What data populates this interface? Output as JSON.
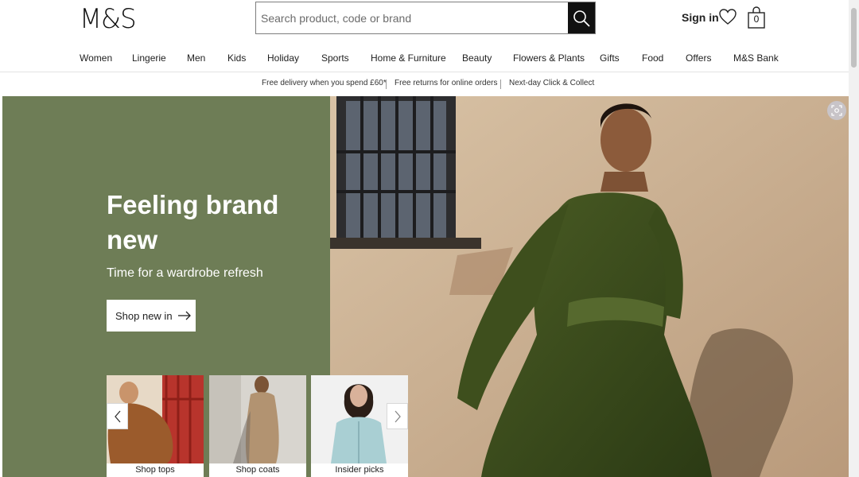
{
  "header": {
    "logo": "M&S",
    "search_placeholder": "Search product, code or brand",
    "sign_in": "Sign in",
    "bag_count": "0"
  },
  "nav": {
    "items": [
      "Women",
      "Lingerie",
      "Men",
      "Kids",
      "Holiday",
      "Sports",
      "Home & Furniture",
      "Beauty",
      "Flowers & Plants",
      "Gifts",
      "Food",
      "Offers",
      "M&S Bank"
    ]
  },
  "promo": {
    "items": [
      "Free delivery when you spend £60*",
      "Free returns for online orders",
      "Next-day Click & Collect"
    ]
  },
  "hero": {
    "title": "Feeling brand new",
    "subtitle": "Time for a wardrobe refresh",
    "cta": "Shop new in"
  },
  "tiles": [
    {
      "label": "Shop tops"
    },
    {
      "label": "Shop coats"
    },
    {
      "label": "Insider picks"
    }
  ],
  "colors": {
    "hero_green": "#6e7d56",
    "dress_green": "#3f4f1f",
    "wall": "#cdb59a"
  }
}
